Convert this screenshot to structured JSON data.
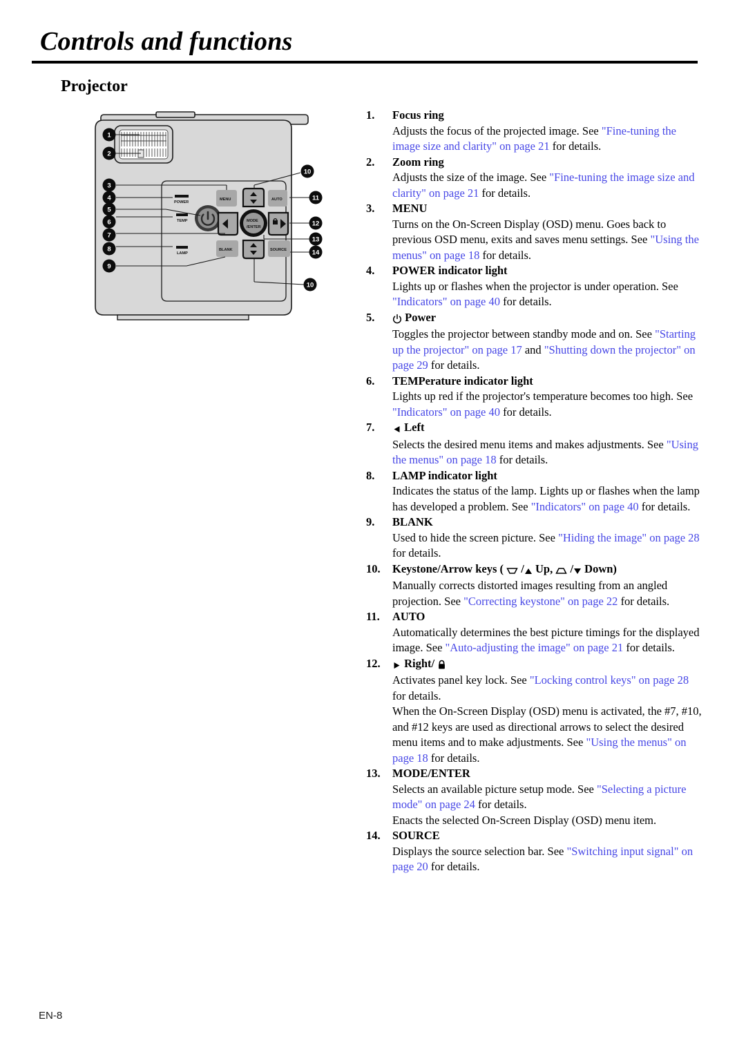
{
  "header": {
    "title": "Controls and functions",
    "section": "Projector"
  },
  "footer": {
    "page_label": "EN-8"
  },
  "colors": {
    "link": "#4646e6",
    "body_gray": "#d8d8d8",
    "button_gray": "#a8a8a8",
    "text": "#000000"
  },
  "diagram": {
    "name": "projector-top-view",
    "callouts_left": [
      "1",
      "2",
      "3",
      "4",
      "5",
      "6",
      "7",
      "8",
      "9"
    ],
    "callouts_right": [
      "10",
      "11",
      "12",
      "13",
      "14",
      "10"
    ],
    "indicator_labels": [
      "POWER",
      "TEMP",
      "LAMP"
    ],
    "button_labels": [
      "MENU",
      "AUTO",
      "MODE/ENTER",
      "BLANK",
      "SOURCE"
    ]
  },
  "items": [
    {
      "num": "1.",
      "label": "Focus ring",
      "icon": "",
      "body": [
        [
          {
            "t": "Adjusts the focus of the projected image. See ",
            "link": false
          },
          {
            "t": "\"Fine-tuning the image size and clarity\" on page 21",
            "link": true
          },
          {
            "t": " for details.",
            "link": false
          }
        ]
      ]
    },
    {
      "num": "2.",
      "label": "Zoom ring",
      "icon": "",
      "body": [
        [
          {
            "t": "Adjusts the size of the image. See ",
            "link": false
          },
          {
            "t": "\"Fine-tuning the image size and clarity\" on page 21",
            "link": true
          },
          {
            "t": " for details.",
            "link": false
          }
        ]
      ]
    },
    {
      "num": "3.",
      "label": "MENU",
      "icon": "",
      "body": [
        [
          {
            "t": "Turns on the On-Screen Display (OSD) menu. Goes back to previous OSD menu, exits and saves menu settings. See ",
            "link": false
          },
          {
            "t": "\"Using the menus\" on page 18",
            "link": true
          },
          {
            "t": " for details.",
            "link": false
          }
        ]
      ]
    },
    {
      "num": "4.",
      "label": "POWER indicator light",
      "icon": "",
      "body": [
        [
          {
            "t": "Lights up or flashes when the projector is under operation. See ",
            "link": false
          },
          {
            "t": "\"Indicators\" on page 40",
            "link": true
          },
          {
            "t": " for details.",
            "link": false
          }
        ]
      ]
    },
    {
      "num": "5.",
      "label": "Power",
      "icon": "power-icon",
      "body": [
        [
          {
            "t": "Toggles the projector between standby mode and on. See ",
            "link": false
          },
          {
            "t": "\"Starting up the projector\" on page 17",
            "link": true
          },
          {
            "t": " and ",
            "link": false
          },
          {
            "t": "\"Shutting down the projector\" on page 29",
            "link": true
          },
          {
            "t": " for details.",
            "link": false
          }
        ]
      ]
    },
    {
      "num": "6.",
      "label": "TEMPerature indicator light",
      "icon": "",
      "body": [
        [
          {
            "t": "Lights up red if the projector's temperature becomes too high. See ",
            "link": false
          },
          {
            "t": "\"Indicators\" on page 40",
            "link": true
          },
          {
            "t": " for details.",
            "link": false
          }
        ]
      ]
    },
    {
      "num": "7.",
      "label": "Left",
      "icon": "left-triangle-icon",
      "body": [
        [
          {
            "t": "Selects the desired menu items and makes adjustments. See ",
            "link": false
          },
          {
            "t": "\"Using the menus\" on page 18",
            "link": true
          },
          {
            "t": " for details.",
            "link": false
          }
        ]
      ]
    },
    {
      "num": "8.",
      "label": "LAMP indicator light",
      "icon": "",
      "body": [
        [
          {
            "t": "Indicates the status of the lamp. Lights up or flashes when the lamp has developed a problem. See ",
            "link": false
          },
          {
            "t": "\"Indicators\" on page 40",
            "link": true
          },
          {
            "t": " for details.",
            "link": false
          }
        ]
      ]
    },
    {
      "num": "9.",
      "label": "BLANK",
      "icon": "",
      "body": [
        [
          {
            "t": "Used to hide the screen picture. See ",
            "link": false
          },
          {
            "t": "\"Hiding the image\" on page 28",
            "link": true
          },
          {
            "t": " for details.",
            "link": false
          }
        ]
      ]
    },
    {
      "num": "10.",
      "label": "Keystone/Arrow keys",
      "icon": "keystone-keys-icon",
      "label_suffix": "( ▽ /▲ Up, △ /▼ Down)",
      "body": [
        [
          {
            "t": "Manually corrects distorted images resulting from an angled projection. See ",
            "link": false
          },
          {
            "t": "\"Correcting keystone\" on page 22",
            "link": true
          },
          {
            "t": " for details.",
            "link": false
          }
        ]
      ]
    },
    {
      "num": "11.",
      "label": "AUTO",
      "icon": "",
      "body": [
        [
          {
            "t": "Automatically determines the best picture timings for the displayed image. See ",
            "link": false
          },
          {
            "t": "\"Auto-adjusting the image\" on page 21",
            "link": true
          },
          {
            "t": " for details.",
            "link": false
          }
        ]
      ]
    },
    {
      "num": "12.",
      "label": "Right/",
      "icon": "right-triangle-lock-icon",
      "body": [
        [
          {
            "t": "Activates panel key lock. See ",
            "link": false
          },
          {
            "t": "\"Locking control keys\" on page 28",
            "link": true
          },
          {
            "t": " for details.",
            "link": false
          }
        ],
        [
          {
            "t": "When the On-Screen Display (OSD) menu is activated, the #7, #10, and #12 keys are used as directional arrows to select the desired menu items and to make adjustments. See ",
            "link": false
          },
          {
            "t": "\"Using the menus\" on page 18",
            "link": true
          },
          {
            "t": " for details.",
            "link": false
          }
        ]
      ]
    },
    {
      "num": "13.",
      "label": "MODE/ENTER",
      "icon": "",
      "body": [
        [
          {
            "t": "Selects an available picture setup mode. See ",
            "link": false
          },
          {
            "t": "\"Selecting a picture mode\" on page 24",
            "link": true
          },
          {
            "t": " for details.",
            "link": false
          }
        ],
        [
          {
            "t": "Enacts the selected On-Screen Display (OSD) menu item.",
            "link": false
          }
        ]
      ]
    },
    {
      "num": "14.",
      "label": "SOURCE",
      "icon": "",
      "body": [
        [
          {
            "t": "Displays the source selection bar. See ",
            "link": false
          },
          {
            "t": "\"Switching input signal\" on page 20",
            "link": true
          },
          {
            "t": " for details.",
            "link": false
          }
        ]
      ]
    }
  ]
}
